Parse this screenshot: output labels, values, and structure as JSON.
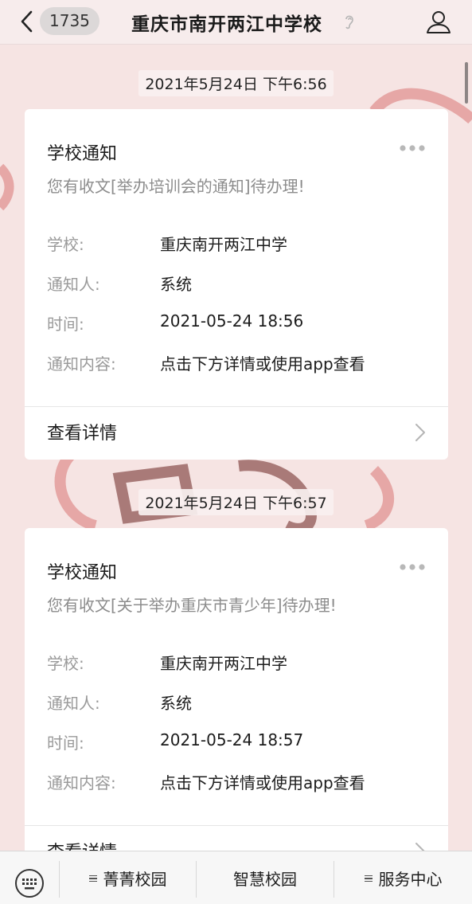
{
  "header": {
    "back_icon": "chevron-left-icon",
    "unread_count": "1735",
    "title": "重庆市南开两江中学校",
    "mute_icon": "ear-icon",
    "profile_icon": "person-icon"
  },
  "messages": [
    {
      "timestamp": "2021年5月24日 下午6:56",
      "card": {
        "title": "学校通知",
        "summary": "您有收文[举办培训会的通知]待办理!",
        "fields": [
          {
            "label": "学校:",
            "value": "重庆南开两江中学"
          },
          {
            "label": "通知人:",
            "value": "系统"
          },
          {
            "label": "时间:",
            "value": "2021-05-24 18:56"
          },
          {
            "label": "通知内容:",
            "value": "点击下方详情或使用app查看"
          }
        ],
        "detail_label": "查看详情"
      }
    },
    {
      "timestamp": "2021年5月24日 下午6:57",
      "card": {
        "title": "学校通知",
        "summary": "您有收文[关于举办重庆市青少年]待办理!",
        "fields": [
          {
            "label": "学校:",
            "value": "重庆南开两江中学"
          },
          {
            "label": "通知人:",
            "value": "系统"
          },
          {
            "label": "时间:",
            "value": "2021-05-24 18:57"
          },
          {
            "label": "通知内容:",
            "value": "点击下方详情或使用app查看"
          }
        ],
        "detail_label": "查看详情"
      }
    }
  ],
  "bottom_menu": {
    "keyboard_icon": "keyboard-icon",
    "items": [
      {
        "label": "菁菁校园",
        "has_submenu": true
      },
      {
        "label": "智慧校园",
        "has_submenu": false
      },
      {
        "label": "服务中心",
        "has_submenu": true
      }
    ]
  },
  "colors": {
    "background": "#f6e4e3",
    "card": "#ffffff",
    "secondary_text": "#9a9a9a"
  }
}
